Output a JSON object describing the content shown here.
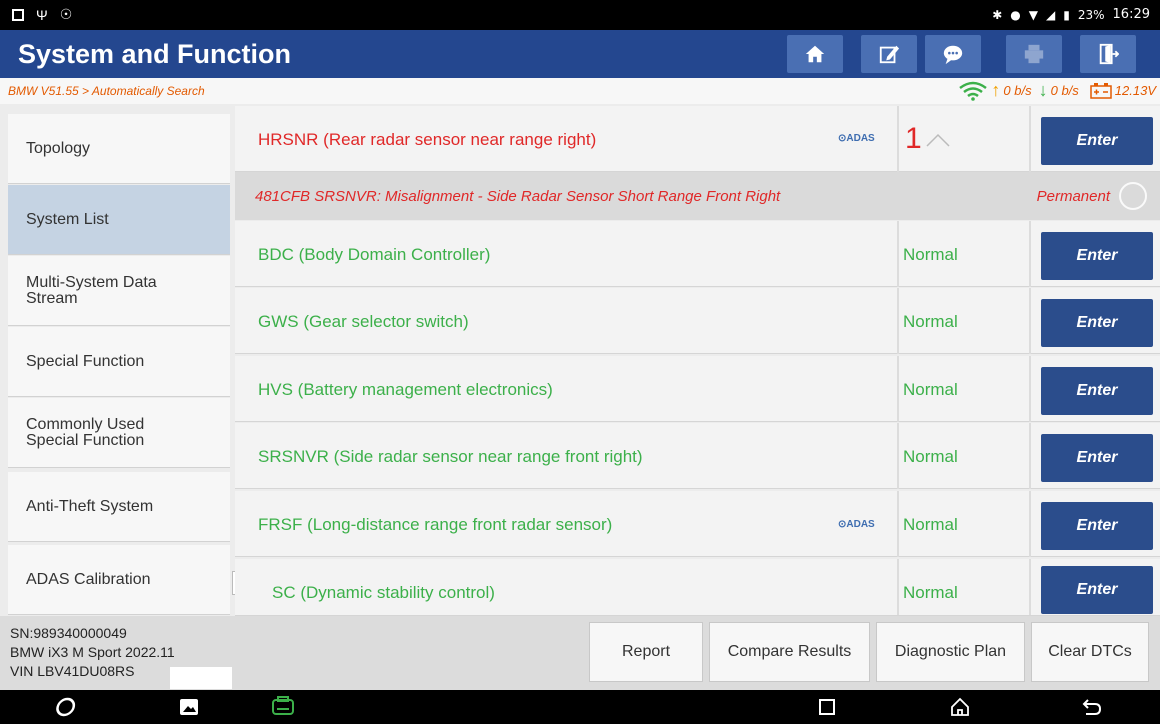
{
  "status_bar": {
    "left_icons": [
      "notification-icon",
      "usb-icon",
      "settings-circle-icon"
    ],
    "battery": "23%",
    "time": "16:29"
  },
  "header": {
    "title": "System and Function",
    "buttons": [
      "home-icon",
      "edit-icon",
      "message-icon",
      "print-icon",
      "exit-icon"
    ]
  },
  "breadcrumb": "BMW V51.55 > Automatically Search",
  "net": {
    "up": "0 b/s",
    "down": "0 b/s",
    "voltage": "12.13V"
  },
  "sidebar": {
    "items": [
      {
        "label": "Topology"
      },
      {
        "label": "System List"
      },
      {
        "label": "Multi-System Data Stream"
      },
      {
        "label": "Special Function"
      },
      {
        "label": "Commonly Used Special Function"
      },
      {
        "label": "Anti-Theft System"
      },
      {
        "label": "ADAS Calibration"
      }
    ],
    "active": "System List",
    "collapse_glyph": "K"
  },
  "systems": [
    {
      "name": "HRSNR (Rear radar sensor near range right)",
      "adas": "ADAS",
      "status": "1",
      "state": "fault",
      "button": "Enter"
    },
    {
      "name": "BDC (Body Domain Controller)",
      "status": "Normal",
      "button": "Enter"
    },
    {
      "name": "GWS (Gear selector switch)",
      "status": "Normal",
      "button": "Enter"
    },
    {
      "name": "HVS (Battery management electronics)",
      "status": "Normal",
      "button": "Enter"
    },
    {
      "name": "SRSNVR (Side radar sensor near range front right)",
      "status": "Normal",
      "button": "Enter"
    },
    {
      "name": "FRSF (Long-distance range front radar sensor)",
      "adas": "ADAS",
      "status": "Normal",
      "button": "Enter"
    },
    {
      "name": "SC (Dynamic stability control)",
      "status": "Normal",
      "button": "Enter"
    }
  ],
  "dtc": {
    "text": "481CFB SRSNVR: Misalignment - Side Radar Sensor Short Range Front Right",
    "state": "Permanent"
  },
  "vehicle": {
    "sn": "SN:989340000049",
    "model": "BMW iX3 M Sport 2022.11",
    "vin": "VIN LBV41DU08RS"
  },
  "footer_buttons": [
    "Report",
    "Compare Results",
    "Diagnostic Plan",
    "Clear DTCs"
  ],
  "colors": {
    "header": "#24478f",
    "normal": "#3cb04a",
    "fault": "#e02828",
    "enter": "#2b4d8c",
    "breadcrumb": "#e35a00"
  }
}
